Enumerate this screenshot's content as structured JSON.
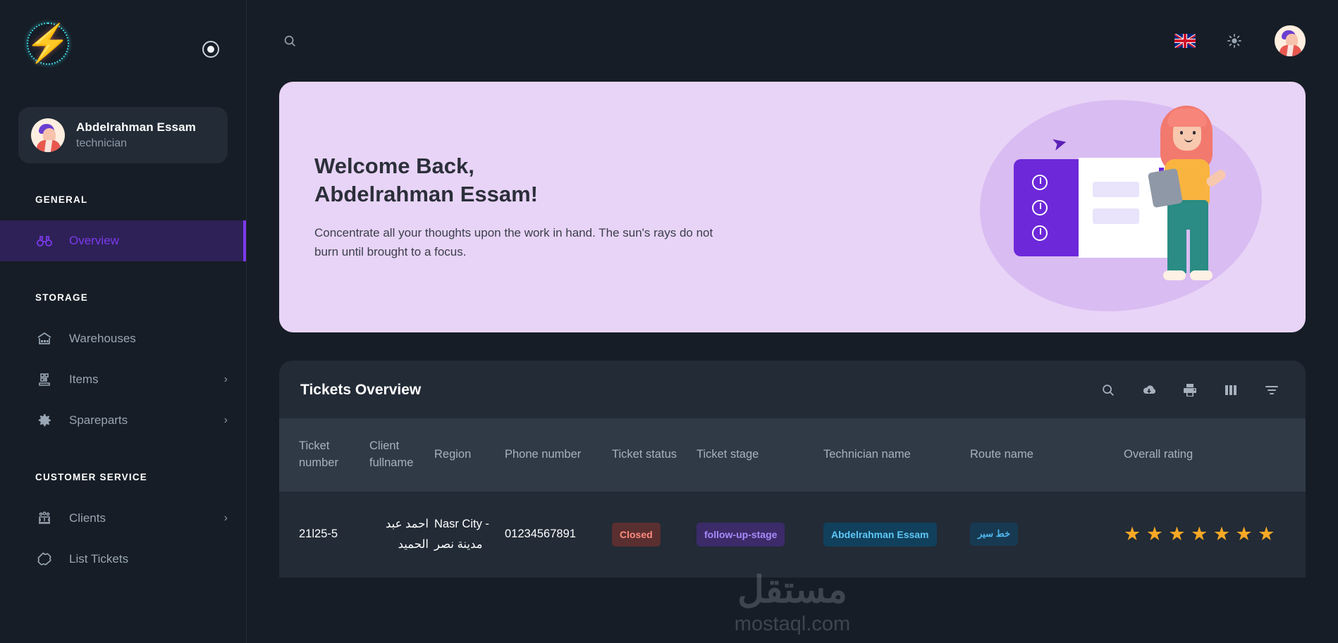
{
  "sidebar": {
    "logo_alt": "lightning-bolt-logo",
    "collapse_toggle": "collapse-sidebar",
    "profile": {
      "name": "Abdelrahman Essam",
      "role": "technician"
    },
    "sections": [
      {
        "title": "GENERAL",
        "items": [
          {
            "label": "Overview",
            "icon": "binoculars-icon",
            "active": true,
            "expandable": false
          }
        ]
      },
      {
        "title": "STORAGE",
        "items": [
          {
            "label": "Warehouses",
            "icon": "warehouse-icon",
            "active": false,
            "expandable": false
          },
          {
            "label": "Items",
            "icon": "items-grid-icon",
            "active": false,
            "expandable": true
          },
          {
            "label": "Spareparts",
            "icon": "gear-icon",
            "active": false,
            "expandable": true
          }
        ]
      },
      {
        "title": "CUSTOMER SERVICE",
        "items": [
          {
            "label": "Clients",
            "icon": "clients-group-icon",
            "active": false,
            "expandable": true
          },
          {
            "label": "List Tickets",
            "icon": "ticket-icon",
            "active": false,
            "expandable": false
          }
        ]
      }
    ]
  },
  "topbar": {
    "search_icon": "search-icon",
    "language_flag": "uk-flag-icon",
    "theme_icon": "sun-icon",
    "avatar": "user-avatar"
  },
  "banner": {
    "greeting_line1": "Welcome Back,",
    "greeting_line2": "Abdelrahman Essam!",
    "subtitle": "Concentrate all your thoughts upon the work in hand. The sun's rays do not burn until brought to a focus."
  },
  "tickets": {
    "title": "Tickets Overview",
    "tools": [
      {
        "name": "search-icon",
        "label": "Search"
      },
      {
        "name": "cloud-download-icon",
        "label": "Export"
      },
      {
        "name": "print-icon",
        "label": "Print"
      },
      {
        "name": "columns-icon",
        "label": "Columns"
      },
      {
        "name": "filter-icon",
        "label": "Filter"
      }
    ],
    "columns": [
      "Ticket number",
      "Client fullname",
      "Region",
      "Phone number",
      "Ticket status",
      "Ticket stage",
      "Technician name",
      "Route name",
      "Overall rating"
    ],
    "rows": [
      {
        "ticket_number": "21l25-5",
        "client_fullname": "احمد عبد الحميد",
        "region": "Nasr City - مدينة نصر",
        "phone_number": "01234567891",
        "ticket_status": "Closed",
        "ticket_stage": "follow-up-stage",
        "technician_name": "Abdelrahman Essam",
        "route_name": "خط سير",
        "overall_rating": 7,
        "rating_glyph": "★"
      }
    ]
  },
  "watermark": {
    "mark": "مستقل",
    "url": "mostaql.com"
  },
  "colors": {
    "accent": "#7c3aed",
    "sidebar_bg": "#161d26",
    "card_bg": "#222b36",
    "banner_bg": "#e8d4f7",
    "status_closed": "#ff8a7d",
    "stage": "#a78bfa",
    "technician": "#5fc7f7",
    "star": "#f9a825"
  }
}
